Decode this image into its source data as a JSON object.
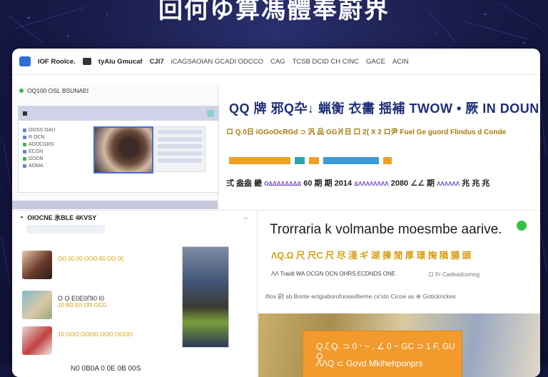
{
  "heading": "回何ゆ算馮體奉蔚界",
  "titlebar": {
    "items": [
      "lOF Roolce.",
      "tyAlu Gmucaf",
      "CJl7",
      "iCAGSAOIAN GCADI ODCCO",
      "CAG",
      "TCSB DCID CH  CINC",
      "GACE",
      "ACIN"
    ]
  },
  "panel_tl": {
    "header": "OQ100 OSL BSUNAEI",
    "list": [
      "OGSS OAU",
      "R OCN",
      "ADOCGRS",
      "ECGN",
      "DODN",
      "AOMA"
    ]
  },
  "panel_tr": {
    "title": "QQ 牌 邪Q卆↓ 蝋衡 衣畵 揺補 TWOW • 厥 IN DOUN",
    "subtitle": "ロ Q.0日 iGGoOcRGd ⊃ 汎 品 GG爿日 口 2( X 2 ロ尹 Fuel Ge guord Flindus d Conde",
    "row": [
      "弍 盎盎 畿",
      "ΟΔΔΔΔΔΔΔΔ",
      "60 期 期  2014",
      "ΔΛΛΛΛΛΛΛΛ",
      "2080 ∠∠ 期",
      "ΛΛΛΛΛΛ",
      "兆 兆 兆"
    ],
    "bar_colors": [
      "#f0a020",
      "#2aa8a8",
      "#f0a020",
      "#3a9bd8",
      "#f0a020"
    ]
  },
  "panel_bl": {
    "header": "OIOCNE 氷BLE 4KVSY",
    "rows": [
      {
        "line1": "ΟΟ 00 00 ΟΟΟ 00 ΟΟ 00"
      },
      {
        "line1": "Ο Ο  Ε0Ε0ΠΙ0 Ι0",
        "line2": "10 BD EII OR OCG"
      },
      {
        "line1": "10 ΟΟΟ ΟΟΟΟ ΟΟΟ ΟΟΟΟ"
      },
      {
        "line1": "N0 0B0A 0 0E 0B 00S"
      }
    ]
  },
  "panel_br": {
    "title": "Trorraria k volmanbe moesmbe aarive.",
    "subtitle": "ΛQ.Ω 尺 尺C 尺 尽 淺 ギ 湖 揀 閒 厚 璟 掬 隕 腸 頭",
    "line1": "ΛΛ Traidt WA OCGN OCN OHRS ECDNDS ONE",
    "line2": "ロ Fr Cadeadcomng",
    "line3": "ifiox 尉 sb Bonte eclgiaborofuosedlieme cs'sto Cicoe ax ⊕ Gotickrickes",
    "card_line1": "Q.ζ Q. ⊃ 0 ‧ ~ . ∠ 0 ~ GC ⊃ 1 F, GU Q",
    "card_line2": "ΛΛQ ⊂ Govd Mkihehponprs"
  }
}
